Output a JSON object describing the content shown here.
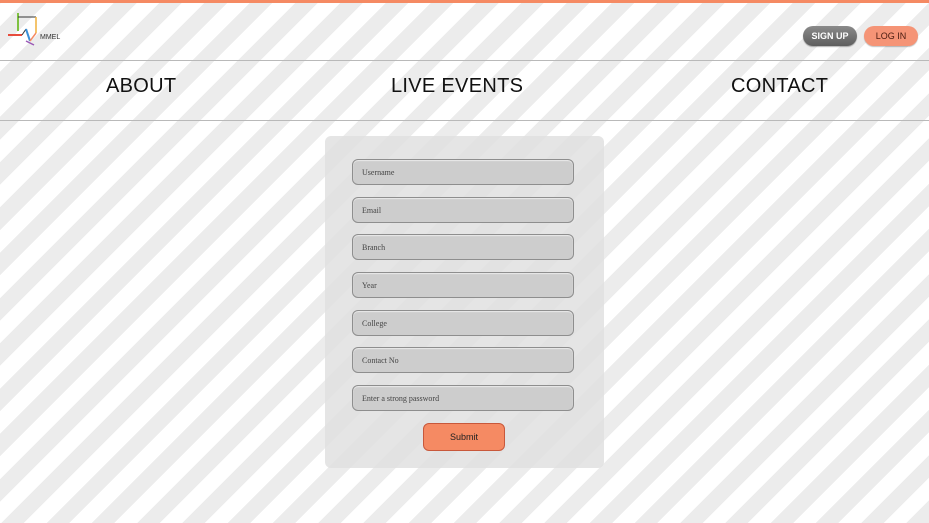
{
  "brand": {
    "name": "MMEL",
    "accent_color": "#f58a63"
  },
  "header": {
    "signup_label": "SIGN UP",
    "login_label": "LOG IN"
  },
  "nav": {
    "items": [
      {
        "label": "ABOUT"
      },
      {
        "label": "LIVE EVENTS"
      },
      {
        "label": "CONTACT"
      }
    ]
  },
  "form": {
    "fields": [
      {
        "placeholder": "Username"
      },
      {
        "placeholder": "Email"
      },
      {
        "placeholder": "Branch"
      },
      {
        "placeholder": "Year"
      },
      {
        "placeholder": "College"
      },
      {
        "placeholder": "Contact No"
      },
      {
        "placeholder": "Enter a strong password"
      }
    ],
    "submit_label": "Submit"
  }
}
